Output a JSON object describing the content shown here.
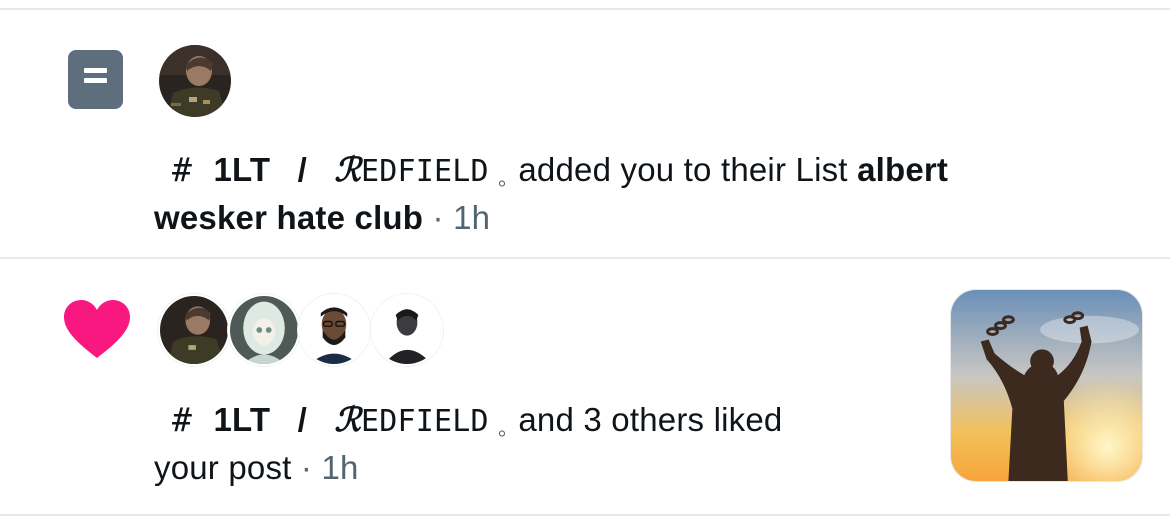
{
  "notifications": [
    {
      "type": "list-add",
      "icon": "list-icon",
      "actor": {
        "prefix": "#",
        "rank": "1LT",
        "slash": "/",
        "initial": "ℛ",
        "name": "EDFIELD",
        "dot": "。"
      },
      "message": "added you to their List",
      "list_name_line1": "albert",
      "list_name_line2": "wesker hate club",
      "separator": "·",
      "time": "1h"
    },
    {
      "type": "like",
      "icon": "heart-icon",
      "icon_color": "#f91880",
      "actor": {
        "prefix": "#",
        "rank": "1LT",
        "slash": "/",
        "initial": "ℛ",
        "name": "EDFIELD",
        "dot": "。"
      },
      "message_line1": "and 3 others liked",
      "message_line2": "your post",
      "separator": "·",
      "time": "1h"
    }
  ],
  "colors": {
    "accent_heart": "#f91880",
    "list_icon_bg": "#5f6e7c",
    "muted_text": "#536471",
    "divider": "#e6e9ec"
  }
}
